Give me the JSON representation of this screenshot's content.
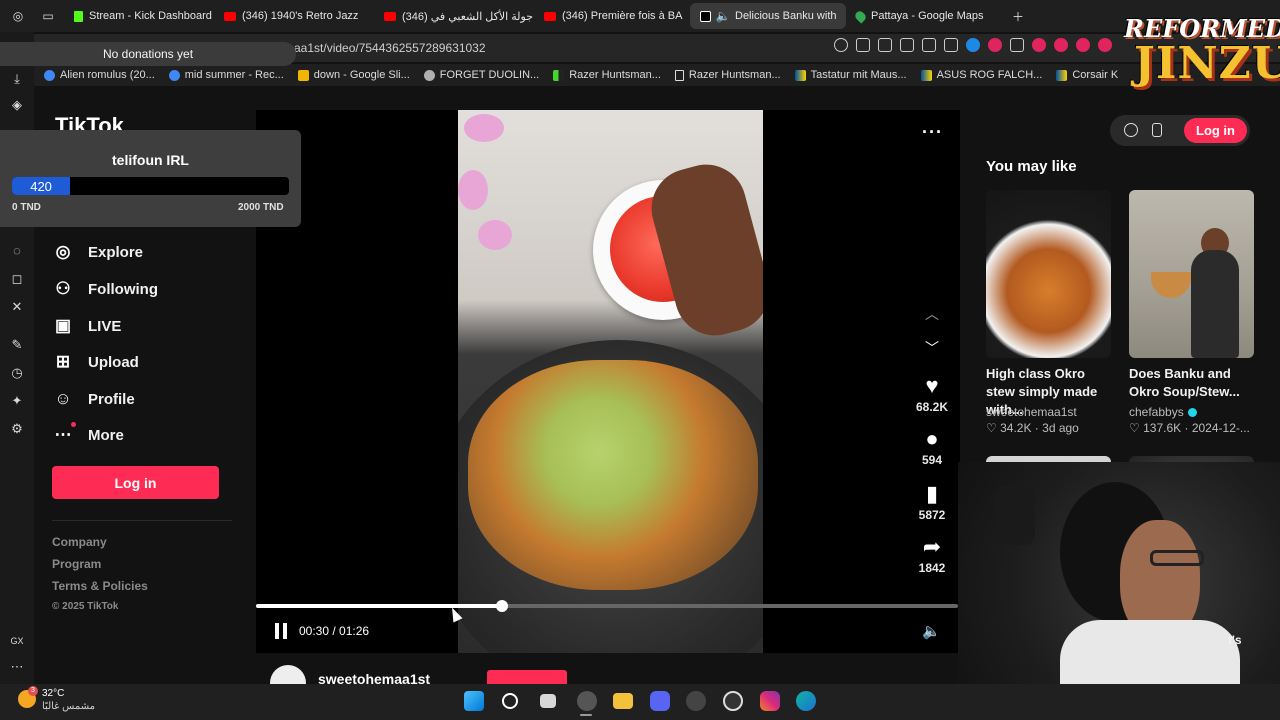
{
  "browser": {
    "tabs": [
      {
        "label": "Stream - Kick Dashboard",
        "icon": "kick-icon",
        "active": false
      },
      {
        "label": "(346) 1940's Retro Jazz",
        "icon": "youtube-icon",
        "active": false
      },
      {
        "label": "(346) جولة الأكل الشعبي في",
        "icon": "youtube-icon",
        "active": false
      },
      {
        "label": "(346) Première fois à BA",
        "icon": "youtube-icon",
        "active": false
      },
      {
        "label": "Delicious Banku with",
        "icon": "tiktok-icon",
        "active": true
      },
      {
        "label": "Pattaya - Google Maps",
        "icon": "maps-icon",
        "active": false
      }
    ],
    "url": "aa1st/video/7544362557289631032",
    "bookmarks": [
      {
        "label": "Alien romulus (20...",
        "icon": "google-icon"
      },
      {
        "label": "mid summer - Rec...",
        "icon": "google-icon"
      },
      {
        "label": "down - Google Sli...",
        "icon": "slides-icon"
      },
      {
        "label": "FORGET DUOLIN...",
        "icon": "threads-icon"
      },
      {
        "label": "Razer Huntsman...",
        "icon": "razer-icon"
      },
      {
        "label": "Razer Huntsman...",
        "icon": "doc-icon"
      },
      {
        "label": "Tastatur mit Maus...",
        "icon": "flag-icon"
      },
      {
        "label": "ASUS ROG FALCH...",
        "icon": "flag-icon"
      },
      {
        "label": "Corsair K",
        "icon": "flag-icon"
      }
    ]
  },
  "overlay": {
    "donation_text": "No donations yet",
    "goal_name": "telifoun IRL",
    "goal_value": "420",
    "goal_progress": 0.21,
    "goal_min": "0 TND",
    "goal_max": "2000 TND",
    "brand_top": "REFORMED",
    "brand_bottom": "JINZU"
  },
  "tiktok": {
    "logo": "TikTok",
    "nav": [
      {
        "label": "Explore",
        "icon": "compass-icon"
      },
      {
        "label": "Following",
        "icon": "following-icon"
      },
      {
        "label": "LIVE",
        "icon": "live-icon"
      },
      {
        "label": "Upload",
        "icon": "upload-icon"
      },
      {
        "label": "Profile",
        "icon": "profile-icon"
      },
      {
        "label": "More",
        "icon": "more-icon"
      }
    ],
    "login_label": "Log in",
    "footer": [
      "Company",
      "Program",
      "Terms & Policies"
    ],
    "copyright": "© 2025 TikTok",
    "header_login": "Log in",
    "actions": {
      "likes": "68.2K",
      "comments": "594",
      "saves": "5872",
      "shares": "1842"
    },
    "player": {
      "time": "00:30 / 01:26",
      "progress": 0.35
    },
    "author": "sweetohemaa1st",
    "recommend_title": "You may like",
    "cards": [
      {
        "caption": "High class Okro stew simply made with...",
        "author": "sweetohemaa1st",
        "verified": false,
        "likes": "34.2K",
        "date": "3d ago"
      },
      {
        "caption": "Does Banku and Okro Soup/Stew...",
        "author": "chefabbys",
        "verified": true,
        "likes": "137.6K",
        "date": "2024-12-..."
      }
    ],
    "partial_text": "t's"
  },
  "taskbar": {
    "temperature": "32°C",
    "condition": "مشمس غالبًا",
    "badge": "3"
  }
}
